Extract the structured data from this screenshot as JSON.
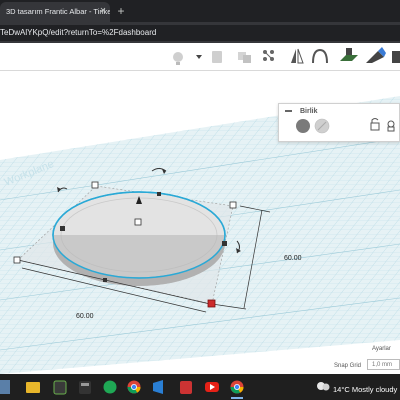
{
  "browser": {
    "tab_title": "3D tasarım Frantic Albar - Tinke",
    "tab_close": "✕",
    "new_tab": "+",
    "url": "TeDwAlYKpQ/edit?returnTo=%2Fdashboard"
  },
  "toolbar": {
    "icons": [
      "lightbulb-icon",
      "dropdown-icon",
      "notes-icon",
      "group-icon",
      "align-icon",
      "mirror-icon",
      "cruise-icon",
      "workplane-icon",
      "ruler-icon"
    ]
  },
  "inspector": {
    "title": "Birlik",
    "solid_color": "#7a7a7a",
    "hole_label": "hole"
  },
  "workplane": {
    "label": "Workplane",
    "dimensions": {
      "length_label": "60.00",
      "width_label": "60.00"
    }
  },
  "settings": {
    "ayarlar_label": "Ayarlar",
    "snap_grid_label": "Snap Grid",
    "snap_grid_value": "1,0 mm"
  },
  "taskbar": {
    "weather_text": "14°C  Mostly cloudy"
  },
  "colors": {
    "grid_line": "#b6dbe6",
    "workplane_fill": "#e6f2f5",
    "shape_top": "#e3e3e3",
    "shape_side": "#a9a9a9",
    "selection_outline": "#2aa9d6",
    "handle_red": "#cc2b2b"
  }
}
